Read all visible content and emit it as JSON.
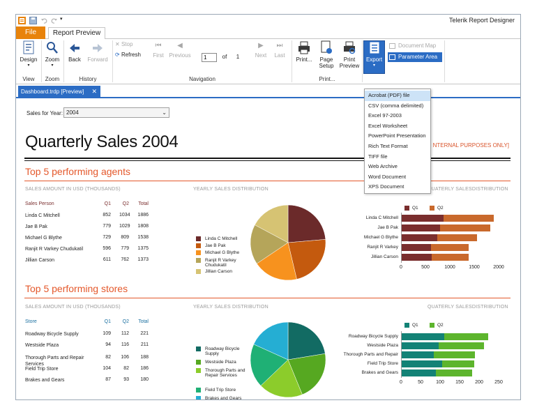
{
  "app_title": "Telerik Report Designer",
  "colors": {
    "accent": "#2b6cc4",
    "file_tab": "#e8830b",
    "section": "#e4582b"
  },
  "ribbon": {
    "tabs": [
      "File",
      "Report Preview"
    ],
    "design": "Design",
    "zoom": "Zoom",
    "back": "Back",
    "forward": "Forward",
    "stop": "Stop",
    "refresh": "Refresh",
    "first": "First",
    "previous": "Previous",
    "page_value": "1",
    "of": "of",
    "total_pages": "1",
    "next": "Next",
    "last": "Last",
    "print": "Print...",
    "page_setup": "Page Setup",
    "print_preview": "Print Preview",
    "export": "Export",
    "document_map": "Document Map",
    "parameter_area": "Parameter Area",
    "groups": {
      "view": "View",
      "zoom": "Zoom",
      "history": "History",
      "navigation": "Navigation",
      "print": "Print..."
    }
  },
  "doc_tab": {
    "label": "Dashboard.trdp [Preview]",
    "close": "✕"
  },
  "export_menu": [
    "Acrobat (PDF) file",
    "CSV (comma delimited)",
    "Excel 97-2003",
    "Excel Worksheet",
    "PowerPoint Presentation",
    "Rich Text Format",
    "TIFF file",
    "Web Archive",
    "Word Document",
    "XPS Document"
  ],
  "report": {
    "sales_for_year_label": "Sales for Year:",
    "year_value": "2004",
    "title": "Quarterly Sales 2004",
    "internal_note": "NTERNAL PURPOSES ONLY]",
    "agents": {
      "section_title": "Top 5 performing agents",
      "amount_head": "SALES AMOUNT IN USD (THOUSANDS)",
      "yearly_head": "YEARLY SALES DISTRIBUTION",
      "quarterly_head": "QUATERLY SALESDISTRIBUTION",
      "columns": [
        "Sales Person",
        "Q1",
        "Q2",
        "Total"
      ],
      "rows": [
        {
          "name": "Linda C Mitchell",
          "q1": "852",
          "q2": "1034",
          "total": "1886"
        },
        {
          "name": "Jae B Pak",
          "q1": "779",
          "q2": "1029",
          "total": "1808"
        },
        {
          "name": "Michael G Blythe",
          "q1": "729",
          "q2": "809",
          "total": "1538"
        },
        {
          "name": "Ranjit R Varkey Chudukatil",
          "q1": "596",
          "q2": "779",
          "total": "1375"
        },
        {
          "name": "Jillian  Carson",
          "q1": "611",
          "q2": "762",
          "total": "1373"
        }
      ],
      "legend": [
        "Linda C Mitchell",
        "Jae B Pak",
        "Michael G Blythe",
        "Ranjit R Varkey Chudukatil",
        "Jillian  Carson"
      ],
      "bar_labels": [
        "Linda C Mitchell",
        "Jae B Pak",
        "Michael G Blythe",
        "Ranjit R Varkey",
        "Jillian  Carson"
      ],
      "pie_colors": [
        "#6b2a2a",
        "#c45a0e",
        "#f7921e",
        "#b5a55a",
        "#d6c373"
      ],
      "q_colors": [
        "#7a2e2e",
        "#c9692c"
      ],
      "q_legend": [
        "Q1",
        "Q2"
      ],
      "x_ticks": [
        "0",
        "500",
        "1000",
        "1500",
        "2000"
      ]
    },
    "stores": {
      "section_title": "Top 5 performing stores",
      "amount_head": "SALES AMOUNT IN USD (THOUSANDS)",
      "yearly_head": "YEARLY SALES DISTRIBUTION",
      "quarterly_head": "QUATERLY SALESDISTRIBUTION",
      "columns": [
        "Store",
        "Q1",
        "Q2",
        "Total"
      ],
      "rows": [
        {
          "name": "Roadway Bicycle Supply",
          "q1": "109",
          "q2": "112",
          "total": "221"
        },
        {
          "name": "Westside Plaza",
          "q1": "94",
          "q2": "116",
          "total": "211"
        },
        {
          "name": "Thorough Parts and Repair Services",
          "q1": "82",
          "q2": "106",
          "total": "188"
        },
        {
          "name": "Field Trip Store",
          "q1": "104",
          "q2": "82",
          "total": "186"
        },
        {
          "name": "Brakes and Gears",
          "q1": "87",
          "q2": "93",
          "total": "180"
        }
      ],
      "legend": [
        "Roadway Bicycle Supply",
        "Westside Plaza",
        "Thorough Parts and Repair Services",
        "Field Trip Store",
        "Brakes and Gears"
      ],
      "bar_labels": [
        "Roadway Bicycle Supply",
        "Westside Plaza",
        "Thorough Parts and Repair",
        "Field Trip Store",
        "Brakes and Gears"
      ],
      "pie_colors": [
        "#126b63",
        "#56a821",
        "#8ccc2b",
        "#1fb075",
        "#25aed3"
      ],
      "q_colors": [
        "#138276",
        "#5db52d"
      ],
      "q_legend": [
        "Q1",
        "Q2"
      ],
      "x_ticks": [
        "0",
        "50",
        "100",
        "150",
        "200",
        "250"
      ]
    }
  },
  "chart_data": [
    {
      "type": "pie",
      "categories": [
        "Linda C Mitchell",
        "Jae B Pak",
        "Michael G Blythe",
        "Ranjit R Varkey Chudukatil",
        "Jillian  Carson"
      ],
      "values": [
        1886,
        1808,
        1538,
        1375,
        1373
      ]
    },
    {
      "type": "bar",
      "categories": [
        "Linda C Mitchell",
        "Jae B Pak",
        "Michael G Blythe",
        "Ranjit R Varkey",
        "Jillian  Carson"
      ],
      "series": [
        {
          "name": "Q1",
          "values": [
            852,
            779,
            729,
            596,
            611
          ]
        },
        {
          "name": "Q2",
          "values": [
            1034,
            1029,
            809,
            779,
            762
          ]
        }
      ],
      "stacked": true,
      "xlim": [
        0,
        2000
      ]
    },
    {
      "type": "pie",
      "categories": [
        "Roadway Bicycle Supply",
        "Westside Plaza",
        "Thorough Parts and Repair Services",
        "Field Trip Store",
        "Brakes and Gears"
      ],
      "values": [
        221,
        211,
        188,
        186,
        180
      ]
    },
    {
      "type": "bar",
      "categories": [
        "Roadway Bicycle Supply",
        "Westside Plaza",
        "Thorough Parts and Repair",
        "Field Trip Store",
        "Brakes and Gears"
      ],
      "series": [
        {
          "name": "Q1",
          "values": [
            109,
            94,
            82,
            104,
            87
          ]
        },
        {
          "name": "Q2",
          "values": [
            112,
            116,
            106,
            82,
            93
          ]
        }
      ],
      "stacked": true,
      "xlim": [
        0,
        250
      ]
    }
  ]
}
